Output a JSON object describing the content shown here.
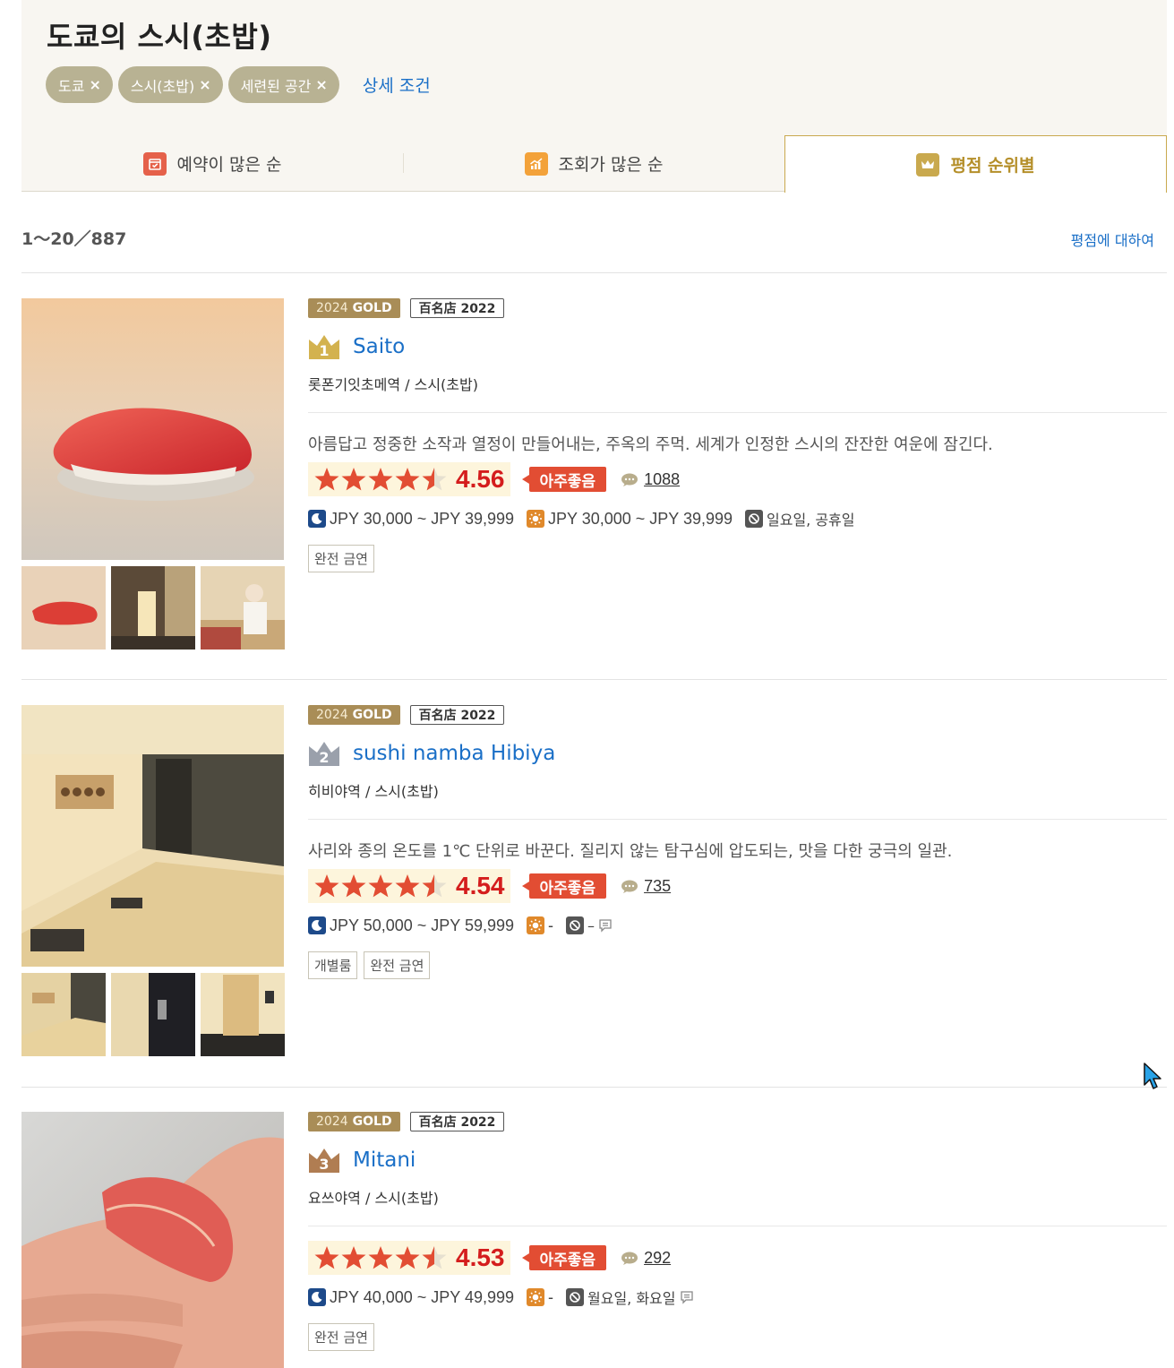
{
  "header": {
    "title": "도쿄의 스시(초밥)",
    "chips": [
      "도쿄",
      "스시(초밥)",
      "세련된 공간"
    ],
    "chip_remove": "×",
    "detail_link": "상세 조건"
  },
  "tabs": [
    {
      "label": "예약이 많은 순",
      "icon": "calendar-icon",
      "color": "#e5614a"
    },
    {
      "label": "조회가 많은 순",
      "icon": "trend-chart-icon",
      "color": "#f3a23a"
    },
    {
      "label": "평점 순위별",
      "icon": "crown-icon",
      "color": "#c9a94e",
      "active": true
    }
  ],
  "result_count": "1～20／887",
  "rating_about": "평점에 대하여",
  "restaurants": [
    {
      "rank": "1",
      "badge_year": "2024",
      "badge_gold": "GOLD",
      "badge_hyakumeiten": "百名店 2022",
      "name": "Saito",
      "area": "롯폰기잇초메역 / 스시(초밥)",
      "pr": "아름답고 정중한 소작과 열정이 만들어내는, 주옥의 주먹. 세계가 인정한 스시의 잔잔한 여운에 잠긴다.",
      "rating": 4.56,
      "rating_text": "4.56",
      "award": "아주좋음",
      "review_count": "1088",
      "dinner_price": "JPY 30,000 ~ JPY 39,999",
      "lunch_price": "JPY 30,000 ~ JPY 39,999",
      "holiday": "일요일, 공휴일",
      "tags": [
        "완전 금연"
      ]
    },
    {
      "rank": "2",
      "badge_year": "2024",
      "badge_gold": "GOLD",
      "badge_hyakumeiten": "百名店 2022",
      "name": "sushi namba Hibiya",
      "area": "히비야역 / 스시(초밥)",
      "pr": "사리와 종의 온도를 1℃ 단위로 바꾼다. 질리지 않는 탐구심에 압도되는, 맛을 다한 궁극의 일관.",
      "rating": 4.54,
      "rating_text": "4.54",
      "award": "아주좋음",
      "review_count": "735",
      "dinner_price": "JPY 50,000 ~ JPY 59,999",
      "lunch_price": "-",
      "holiday": "–",
      "tags": [
        "개별룸",
        "완전 금연"
      ]
    },
    {
      "rank": "3",
      "badge_year": "2024",
      "badge_gold": "GOLD",
      "badge_hyakumeiten": "百名店 2022",
      "name": "Mitani",
      "area": "요쓰야역 / 스시(초밥)",
      "pr": "",
      "rating": 4.53,
      "rating_text": "4.53",
      "award": "아주좋음",
      "review_count": "292",
      "dinner_price": "JPY 40,000 ~ JPY 49,999",
      "lunch_price": "-",
      "holiday": "월요일, 화요일",
      "tags": [
        "완전 금연"
      ]
    }
  ],
  "colors": {
    "accent_link": "#1a6fc7",
    "score_red": "#d41d1d",
    "award_red": "#e24d33",
    "star_red": "#e24d33",
    "gold": "#a98d57"
  }
}
